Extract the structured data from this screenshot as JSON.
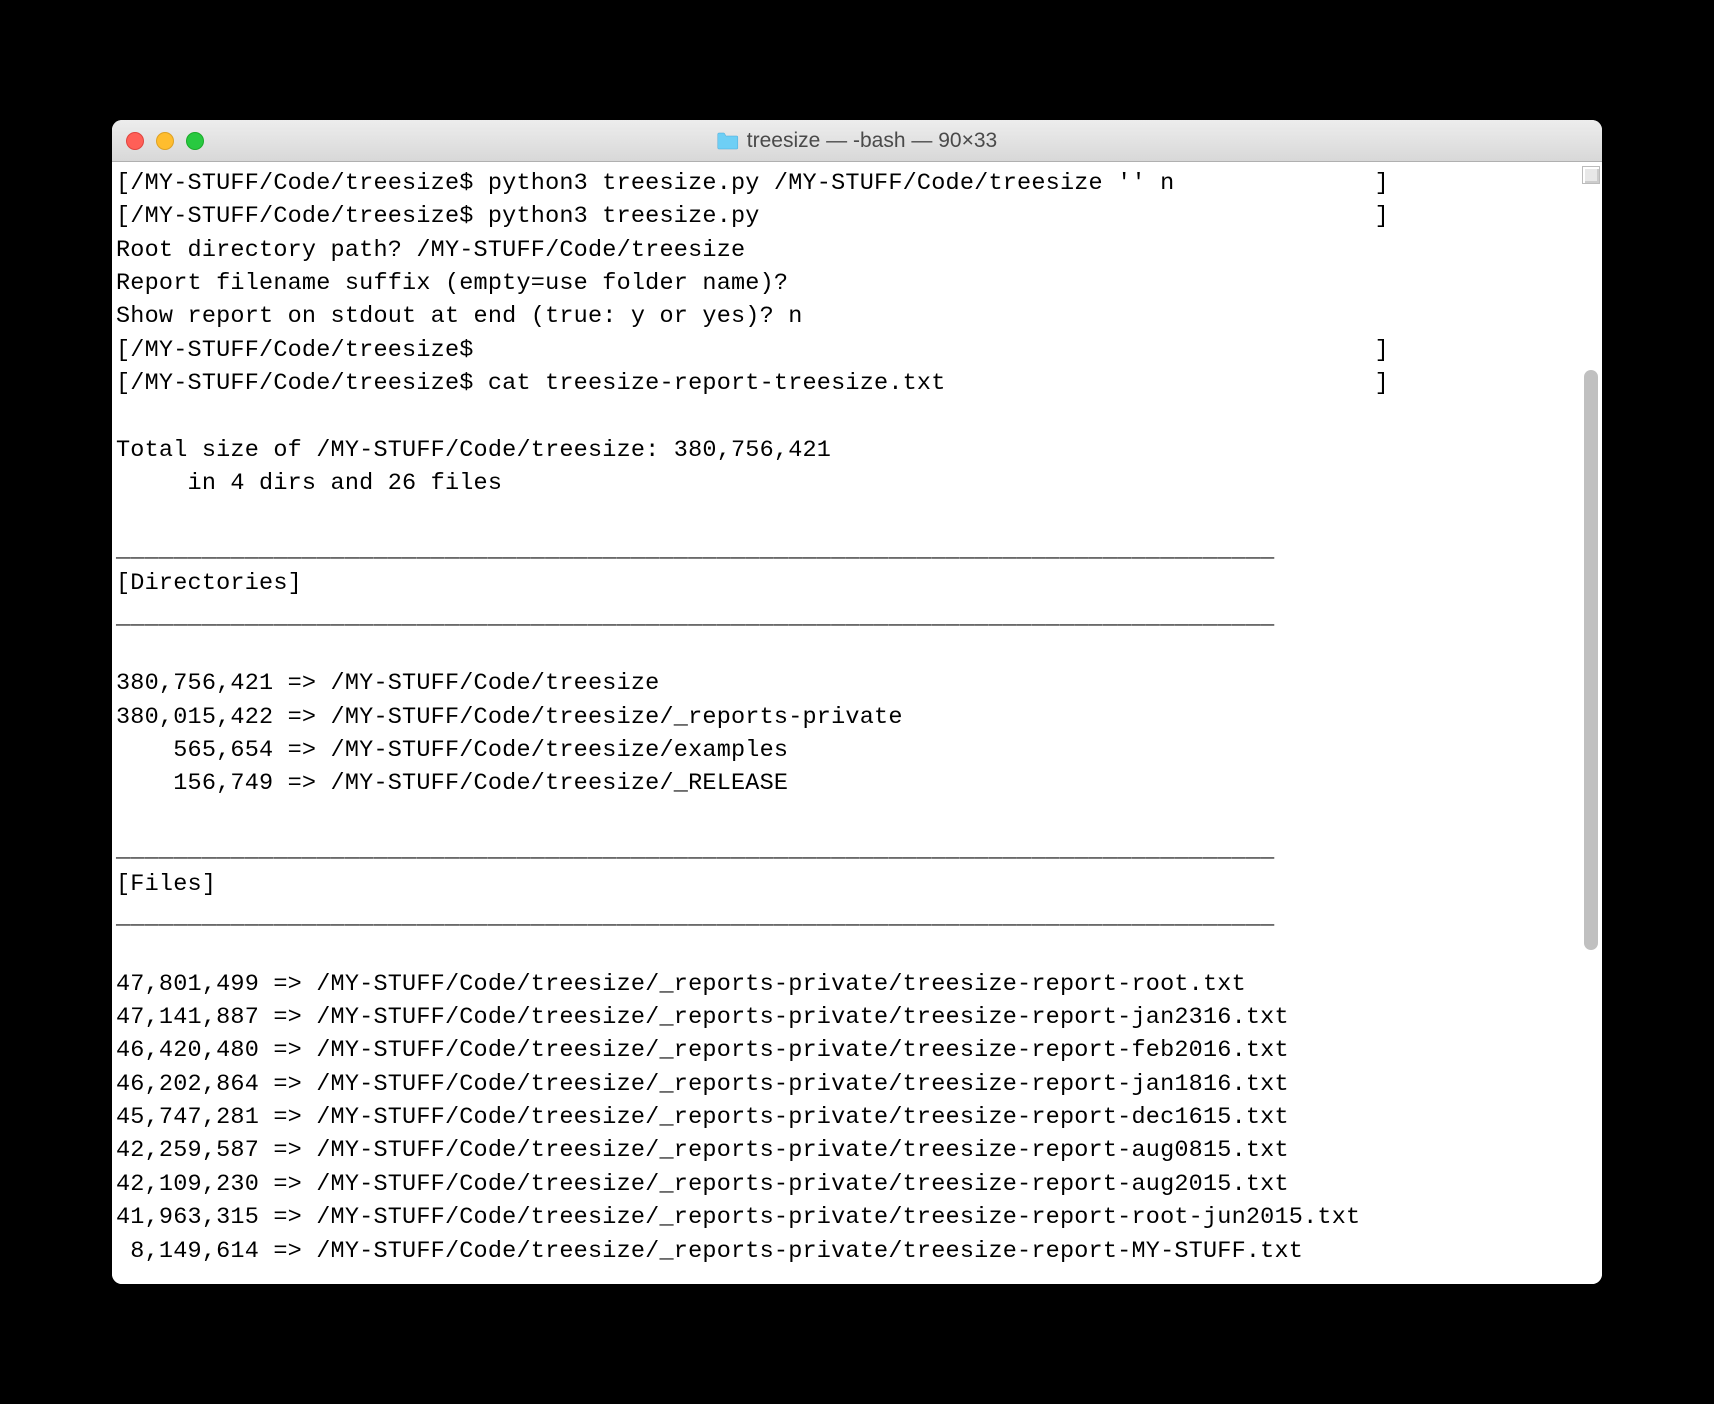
{
  "window": {
    "title": "treesize — -bash — 90×33"
  },
  "terminal": {
    "lines": [
      "[/MY-STUFF/Code/treesize$ python3 treesize.py /MY-STUFF/Code/treesize '' n              ]",
      "[/MY-STUFF/Code/treesize$ python3 treesize.py                                           ]",
      "Root directory path? /MY-STUFF/Code/treesize",
      "Report filename suffix (empty=use folder name)?",
      "Show report on stdout at end (true: y or yes)? n",
      "[/MY-STUFF/Code/treesize$                                                               ]",
      "[/MY-STUFF/Code/treesize$ cat treesize-report-treesize.txt                              ]",
      "",
      "Total size of /MY-STUFF/Code/treesize: 380,756,421",
      "     in 4 dirs and 26 files",
      "",
      "_________________________________________________________________________________",
      "[Directories]",
      "_________________________________________________________________________________",
      "",
      "380,756,421 => /MY-STUFF/Code/treesize",
      "380,015,422 => /MY-STUFF/Code/treesize/_reports-private",
      "    565,654 => /MY-STUFF/Code/treesize/examples",
      "    156,749 => /MY-STUFF/Code/treesize/_RELEASE",
      "",
      "_________________________________________________________________________________",
      "[Files]",
      "_________________________________________________________________________________",
      "",
      "47,801,499 => /MY-STUFF/Code/treesize/_reports-private/treesize-report-root.txt",
      "47,141,887 => /MY-STUFF/Code/treesize/_reports-private/treesize-report-jan2316.txt",
      "46,420,480 => /MY-STUFF/Code/treesize/_reports-private/treesize-report-feb2016.txt",
      "46,202,864 => /MY-STUFF/Code/treesize/_reports-private/treesize-report-jan1816.txt",
      "45,747,281 => /MY-STUFF/Code/treesize/_reports-private/treesize-report-dec1615.txt",
      "42,259,587 => /MY-STUFF/Code/treesize/_reports-private/treesize-report-aug0815.txt",
      "42,109,230 => /MY-STUFF/Code/treesize/_reports-private/treesize-report-aug2015.txt",
      "41,963,315 => /MY-STUFF/Code/treesize/_reports-private/treesize-report-root-jun2015.txt",
      " 8,149,614 => /MY-STUFF/Code/treesize/_reports-private/treesize-report-MY-STUFF.txt"
    ]
  }
}
